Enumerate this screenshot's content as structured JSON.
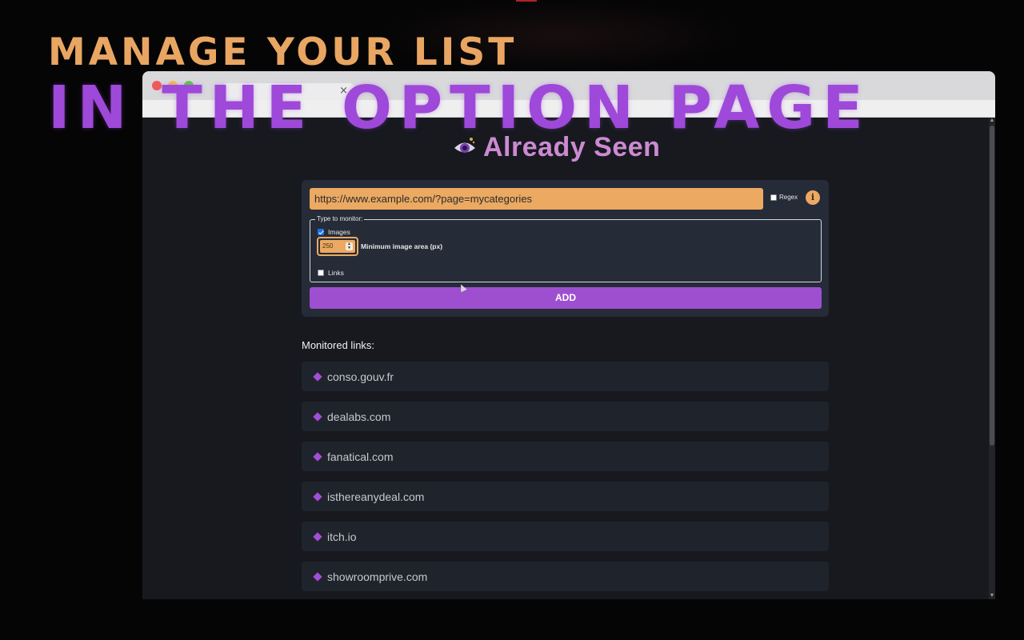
{
  "headline": {
    "line1": "MANAGE YOUR LIST",
    "line2": "IN THE OPTION PAGE"
  },
  "browser": {
    "tab_close": "×"
  },
  "app": {
    "title": "Already Seen",
    "url_input": {
      "value": "https://www.example.com/?page=mycategories"
    },
    "regex_label": "Regex",
    "info_button": "i",
    "type_to_monitor": {
      "legend": "Type to monitor:",
      "images_label": "Images",
      "images_checked": true,
      "min_area_value": "250",
      "min_area_label": "Minimum image area (px)",
      "links_label": "Links",
      "links_checked": false
    },
    "add_button": "ADD",
    "monitored_title": "Monitored links:",
    "monitored_links": [
      "conso.gouv.fr",
      "dealabs.com",
      "fanatical.com",
      "isthereanydeal.com",
      "itch.io",
      "showroomprive.com"
    ]
  },
  "colors": {
    "accent_orange": "#eba962",
    "accent_purple": "#9e4fd0",
    "background": "#17191f",
    "panel": "#262b38"
  },
  "icons": {
    "logo": "eye-icon",
    "list_marker": "diamond-icon",
    "info": "info-icon"
  }
}
